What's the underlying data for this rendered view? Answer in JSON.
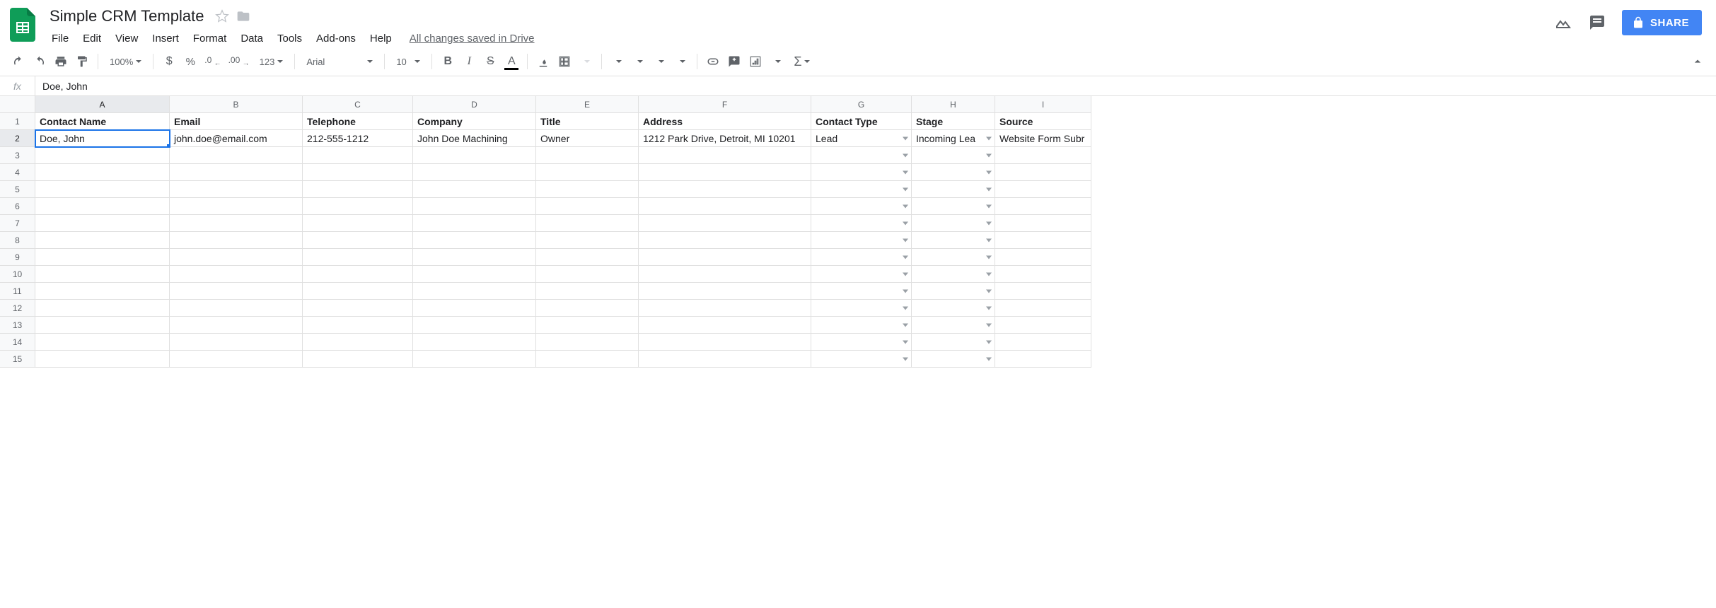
{
  "doc": {
    "title": "Simple CRM Template",
    "save_status": "All changes saved in Drive"
  },
  "menubar": [
    "File",
    "Edit",
    "View",
    "Insert",
    "Format",
    "Data",
    "Tools",
    "Add-ons",
    "Help"
  ],
  "share_label": "SHARE",
  "toolbar": {
    "zoom": "100%",
    "font": "Arial",
    "font_size": "10"
  },
  "formula_bar": {
    "fx": "fx",
    "value": "Doe, John"
  },
  "columns": [
    "A",
    "B",
    "C",
    "D",
    "E",
    "F",
    "G",
    "H",
    "I"
  ],
  "selected_col": "A",
  "selected_row": 2,
  "row_count": 15,
  "headers": [
    "Contact Name",
    "Email",
    "Telephone",
    "Company",
    "Title",
    "Address",
    "Contact Type",
    "Stage",
    "Source"
  ],
  "dropdown_cols": [
    6,
    7
  ],
  "data_rows": [
    [
      "Doe, John",
      "john.doe@email.com",
      "212-555-1212",
      "John Doe Machining",
      "Owner",
      "1212 Park Drive, Detroit, MI 10201",
      "Lead",
      "Incoming Lea",
      "Website Form Subr"
    ]
  ],
  "selected_cell": {
    "row": 2,
    "col": 0
  }
}
